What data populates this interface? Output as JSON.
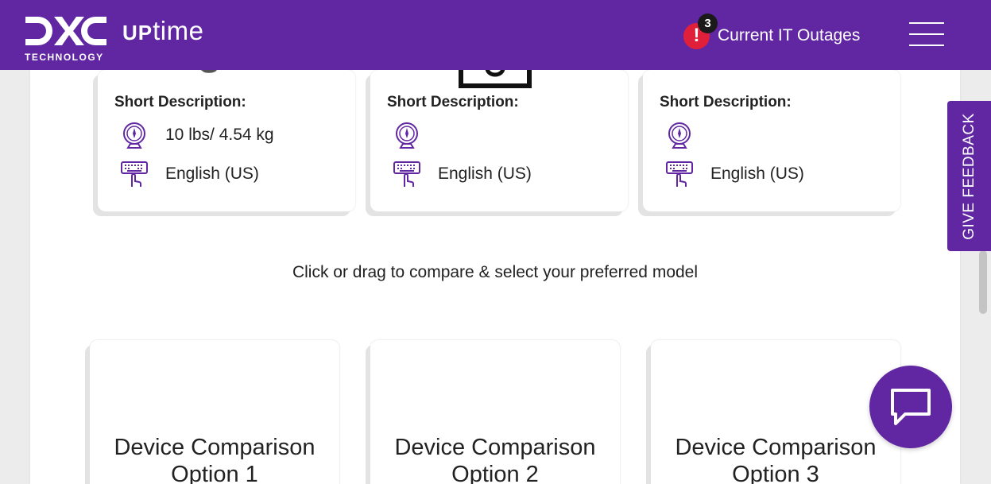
{
  "header": {
    "logo_text": "DXC",
    "logo_subtext": "TECHNOLOGY",
    "app_name_prefix": "UP",
    "app_name_suffix": "time",
    "outage_count": "3",
    "outage_label": "Current IT Outages",
    "alert_symbol": "!"
  },
  "specs": {
    "cards": [
      {
        "title": "Short Description:",
        "weight": "10 lbs/ 4.54 kg",
        "keyboard": "English (US)"
      },
      {
        "title": "Short Description:",
        "weight": "",
        "keyboard": "English (US)"
      },
      {
        "title": "Short Description:",
        "weight": "",
        "keyboard": "English (US)"
      }
    ]
  },
  "compare": {
    "prompt": "Click or drag to compare & select your preferred model",
    "options": [
      {
        "label": "Device Comparison Option 1"
      },
      {
        "label": "Device Comparison Option 2"
      },
      {
        "label": "Device Comparison Option 3"
      }
    ]
  },
  "feedback": {
    "label": "GIVE FEEDBACK"
  },
  "icons": {
    "weight": "scale-icon",
    "keyboard": "keyboard-touch-icon",
    "chat": "chat-bubble-icon",
    "menu": "hamburger-menu-icon",
    "alert": "alert-icon"
  },
  "colors": {
    "brand": "#6127a3",
    "alert": "#e0203a"
  }
}
